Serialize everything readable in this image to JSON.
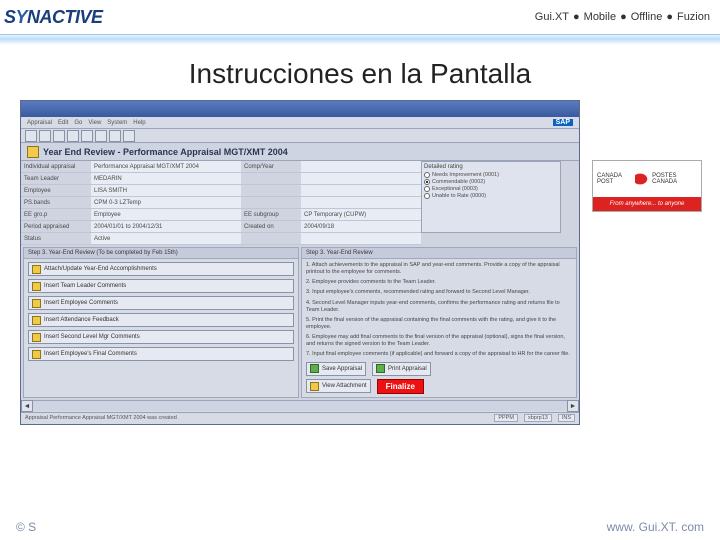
{
  "header": {
    "logo_pre": "S",
    "logo_y": "Y",
    "logo_rest": "NACTIVE",
    "products": [
      "Gui.XT",
      "Mobile",
      "Offline",
      "Fuzion"
    ]
  },
  "slide_title": "Instrucciones en la Pantalla",
  "sap": {
    "menu": [
      "Appraisal",
      "Edit",
      "Go",
      "View",
      "System",
      "Help"
    ],
    "brand": "SAP",
    "app_title": "Year End Review - Performance Appraisal MGT/XMT 2004",
    "fields": {
      "rows": [
        {
          "l": "Individual appraisal",
          "v": "Performance Appraisal MGT/XMT 2004",
          "l2": "Comp/Year",
          "v2": ""
        },
        {
          "l": "Team Leader",
          "v": "MEDARIN",
          "l2": "",
          "v2": ""
        },
        {
          "l": "Employee",
          "v": "LISA SMITH",
          "l2": "",
          "v2": ""
        },
        {
          "l": "PS.bands",
          "v": "CPM 0-3 LZTemp",
          "l2": "",
          "v2": ""
        },
        {
          "l": "EE gro.p",
          "v": "Employee",
          "l2": "EE subgroup",
          "v2": "CP  Temporary (CUPW)"
        },
        {
          "l": "Period appraised",
          "v": "2004/01/01  to  2004/12/31",
          "l2": "Created on",
          "v2": "2004/09/18"
        },
        {
          "l": "Status",
          "v": "Active",
          "l2": "",
          "v2": ""
        }
      ],
      "rating": {
        "title": "Detailed rating",
        "options": [
          {
            "label": "Needs Improvement (0001)",
            "sel": false
          },
          {
            "label": "Commendable (0002)",
            "sel": true
          },
          {
            "label": "Exceptional (0003)",
            "sel": false
          },
          {
            "label": "Unable to Rate (0000)",
            "sel": false
          }
        ]
      }
    },
    "steps": {
      "left": {
        "header": "Step 3. Year-End Review (To be completed by Feb 15th)",
        "buttons": [
          "Attach/Update Year-End Accomplishments",
          "Insert Team Leader Comments",
          "Insert Employee Comments",
          "Insert Attendance Feedback",
          "Insert Second Level Mgr Comments",
          "Insert Employee's Final Comments"
        ]
      },
      "right": {
        "header": "Step 3. Year-End Review",
        "instructions": [
          "1. Attach achievements to the appraisal in SAP and year-end comments. Provide a copy of the appraisal printout to the employee for comments.",
          "2. Employee provides comments to the Team Leader.",
          "3. Input employee's comments, recommended rating and forward to Second Level Manager.",
          "4. Second Level Manager inputs year-end comments, confirms the performance rating and returns file to Team Leader.",
          "5. Print the final version of the appraisal containing the final comments with the rating, and give it to the employee.",
          "6. Employee may add final comments to the final version of the appraisal (optional), signs the final version, and returns the signed version to the Team Leader.",
          "7. Input final employee comments (if applicable) and forward a copy of the appraisal to HR for the career file."
        ],
        "btn_save": "Save Appraisal",
        "btn_print": "Print Appraisal",
        "btn_view": "View Attachment",
        "btn_finalize": "Finalize"
      }
    },
    "status_left": "Appraisal Performance Appraisal MGT/XMT 2004 was created",
    "status_segs": [
      "PPPM",
      "sbprp13",
      "INS"
    ]
  },
  "cp": {
    "left": "CANADA POST",
    "right": "POSTES CANADA",
    "tag": "From anywhere... to anyone"
  },
  "footer": {
    "left": "© S",
    "right": "www. Gui.XT. com"
  }
}
